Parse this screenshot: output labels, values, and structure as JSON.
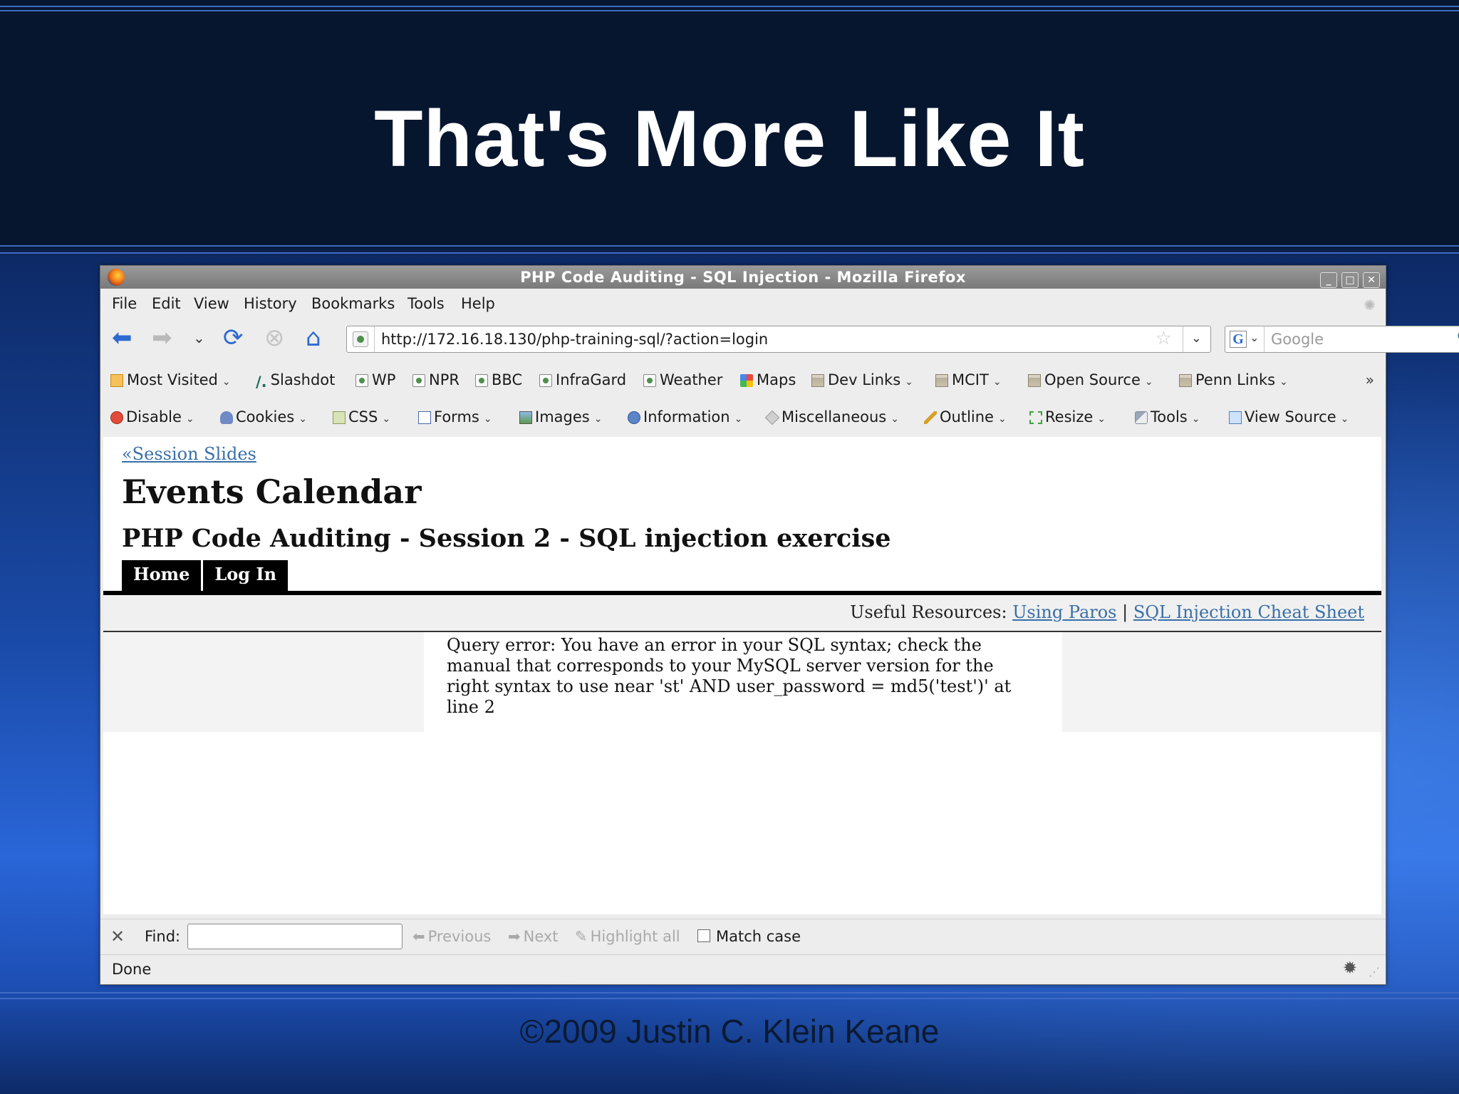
{
  "slide": {
    "title": "That's More Like It",
    "footer": "©2009 Justin C. Klein Keane"
  },
  "window": {
    "title": "PHP Code Auditing - SQL Injection - Mozilla Firefox"
  },
  "menu": [
    "File",
    "Edit",
    "View",
    "History",
    "Bookmarks",
    "Tools",
    "Help"
  ],
  "nav": {
    "url": "http://172.16.18.130/php-training-sql/?action=login",
    "search_placeholder": "Google"
  },
  "bookmarks": {
    "items": [
      "Most Visited",
      "Slashdot",
      "WP",
      "NPR",
      "BBC",
      "InfraGard",
      "Weather",
      "Maps",
      "Dev Links",
      "MCIT",
      "Open Source",
      "Penn Links"
    ],
    "more": "»"
  },
  "devtoolbar": {
    "items": [
      "Disable",
      "Cookies",
      "CSS",
      "Forms",
      "Images",
      "Information",
      "Miscellaneous",
      "Outline",
      "Resize",
      "Tools",
      "View Source"
    ]
  },
  "page": {
    "session_link": "«Session Slides",
    "heading": "Events Calendar",
    "subheading": "PHP Code Auditing - Session 2 - SQL injection exercise",
    "tabs": [
      "Home",
      "Log In"
    ],
    "resources_label": "Useful Resources:",
    "resources_link1": "Using Paros",
    "resources_sep": "|",
    "resources_link2": "SQL Injection Cheat Sheet",
    "query_error": "Query error: You have an error in your SQL syntax; check the manual that corresponds to your MySQL server version for the right syntax to use near 'st' AND user_password = md5('test')' at line 2"
  },
  "findbar": {
    "label": "Find:",
    "value": "",
    "previous": "Previous",
    "next": "Next",
    "highlight": "Highlight all",
    "match_case": "Match case"
  },
  "status": {
    "text": "Done"
  }
}
